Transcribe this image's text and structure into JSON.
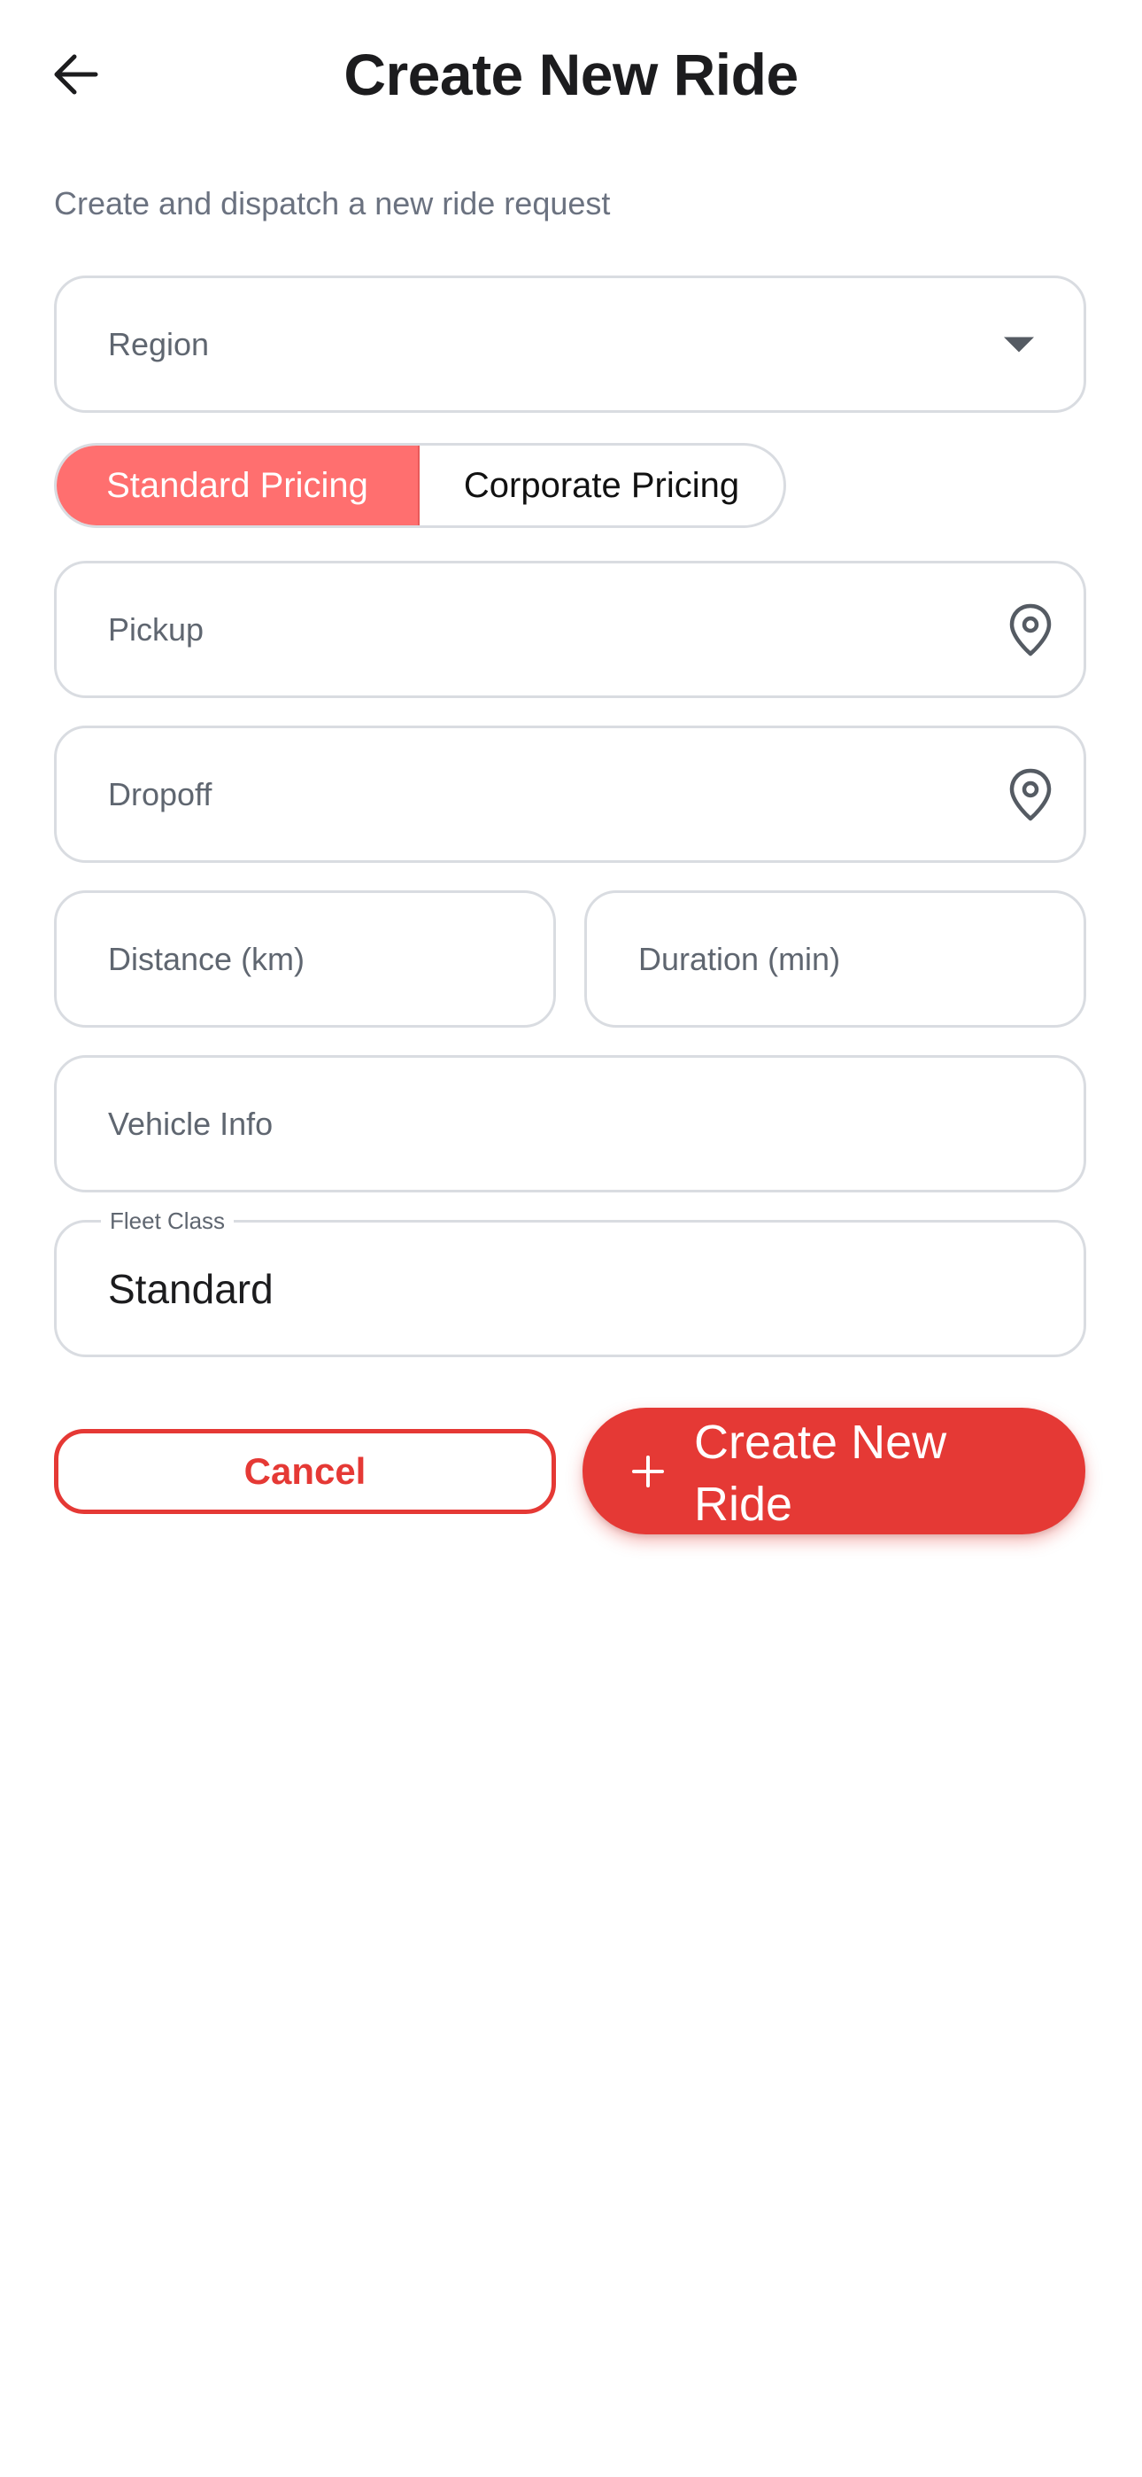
{
  "header": {
    "title": "Create New Ride",
    "back_icon": "arrow-left-icon"
  },
  "subtitle": "Create and dispatch a new ride request",
  "form": {
    "region": {
      "placeholder": "Region",
      "icon": "chevron-down-icon"
    },
    "pricing": {
      "options": [
        "Standard Pricing",
        "Corporate Pricing"
      ],
      "selected": "Standard Pricing"
    },
    "pickup": {
      "placeholder": "Pickup",
      "icon": "map-pin-icon"
    },
    "dropoff": {
      "placeholder": "Dropoff",
      "icon": "map-pin-icon"
    },
    "distance": {
      "placeholder": "Distance (km)"
    },
    "duration": {
      "placeholder": "Duration (min)"
    },
    "vehicle_info": {
      "placeholder": "Vehicle Info"
    },
    "fleet_class": {
      "label": "Fleet Class",
      "value": "Standard"
    }
  },
  "actions": {
    "cancel_label": "Cancel",
    "create_label": "Create New Ride",
    "create_icon": "plus-icon"
  },
  "colors": {
    "accent": "#e53935",
    "segment_active": "#ff6f6f",
    "border": "#d9dce1",
    "placeholder": "#5f6670"
  }
}
